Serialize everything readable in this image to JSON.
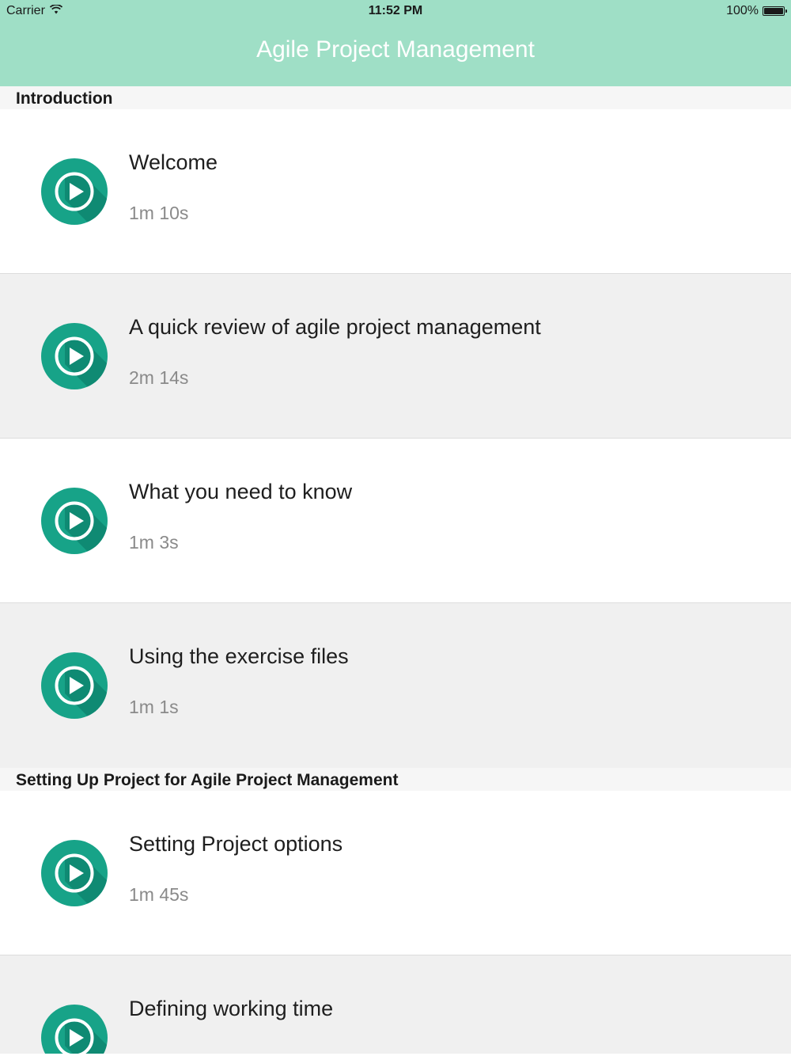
{
  "status_bar": {
    "carrier": "Carrier",
    "time": "11:52 PM",
    "battery": "100%"
  },
  "nav": {
    "title": "Agile Project Management"
  },
  "sections": [
    {
      "header": "Introduction",
      "items": [
        {
          "title": "Welcome",
          "duration": "1m 10s"
        },
        {
          "title": "A quick review of agile project management",
          "duration": "2m 14s"
        },
        {
          "title": "What you need to know",
          "duration": "1m 3s"
        },
        {
          "title": "Using the exercise files",
          "duration": "1m 1s"
        }
      ]
    },
    {
      "header": "Setting Up Project for Agile Project Management",
      "items": [
        {
          "title": "Setting Project options",
          "duration": "1m 45s"
        },
        {
          "title": "Defining working time",
          "duration": ""
        }
      ]
    }
  ],
  "colors": {
    "nav_background": "#9fdfc6",
    "play_button": "#17a388"
  },
  "icons": {
    "play": "play-icon",
    "wifi": "wifi-icon",
    "battery": "battery-icon"
  }
}
